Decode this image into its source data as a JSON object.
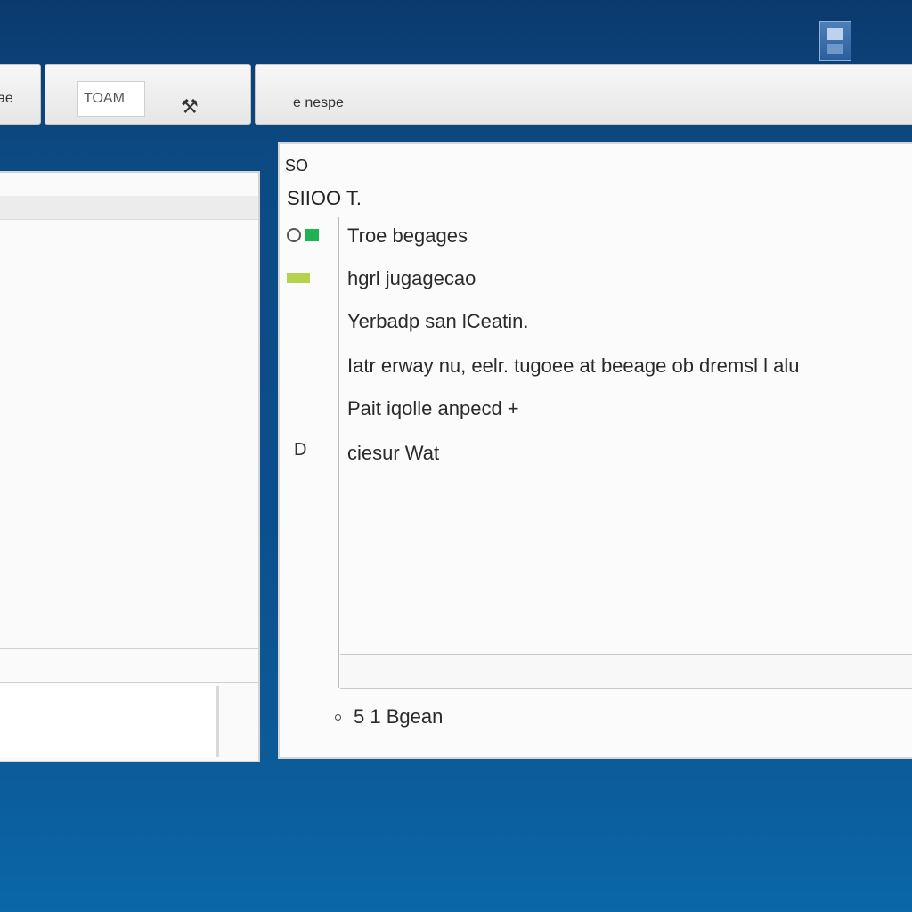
{
  "toolbar": {
    "left_label": "ae",
    "field_value": "TOAM",
    "tool_icon": "tool-icon",
    "right_label": "e nespe"
  },
  "main_panel": {
    "title_small": "SO",
    "title_big": "SIIOO T.",
    "rows": [
      {
        "marker": "circle-green",
        "text": "Troe begages"
      },
      {
        "marker": "yellow-bar",
        "text": "hgrl jugagecao"
      },
      {
        "marker": "none",
        "text": "Yerbadp  san lCeatin."
      },
      {
        "marker": "none",
        "text": "Iatr erway  nu, eelr. tugoee  at  beeage  ob  dremsl  l  alu"
      },
      {
        "marker": "none",
        "text": "Pait iqolle anpecd +"
      },
      {
        "marker": "D",
        "text": "ciesur Wat"
      }
    ],
    "footer_text": "5 1 Bgean"
  },
  "colors": {
    "desktop": "#0b4f8c",
    "status_green": "#1fb253",
    "status_yellow": "#b3d44a"
  }
}
